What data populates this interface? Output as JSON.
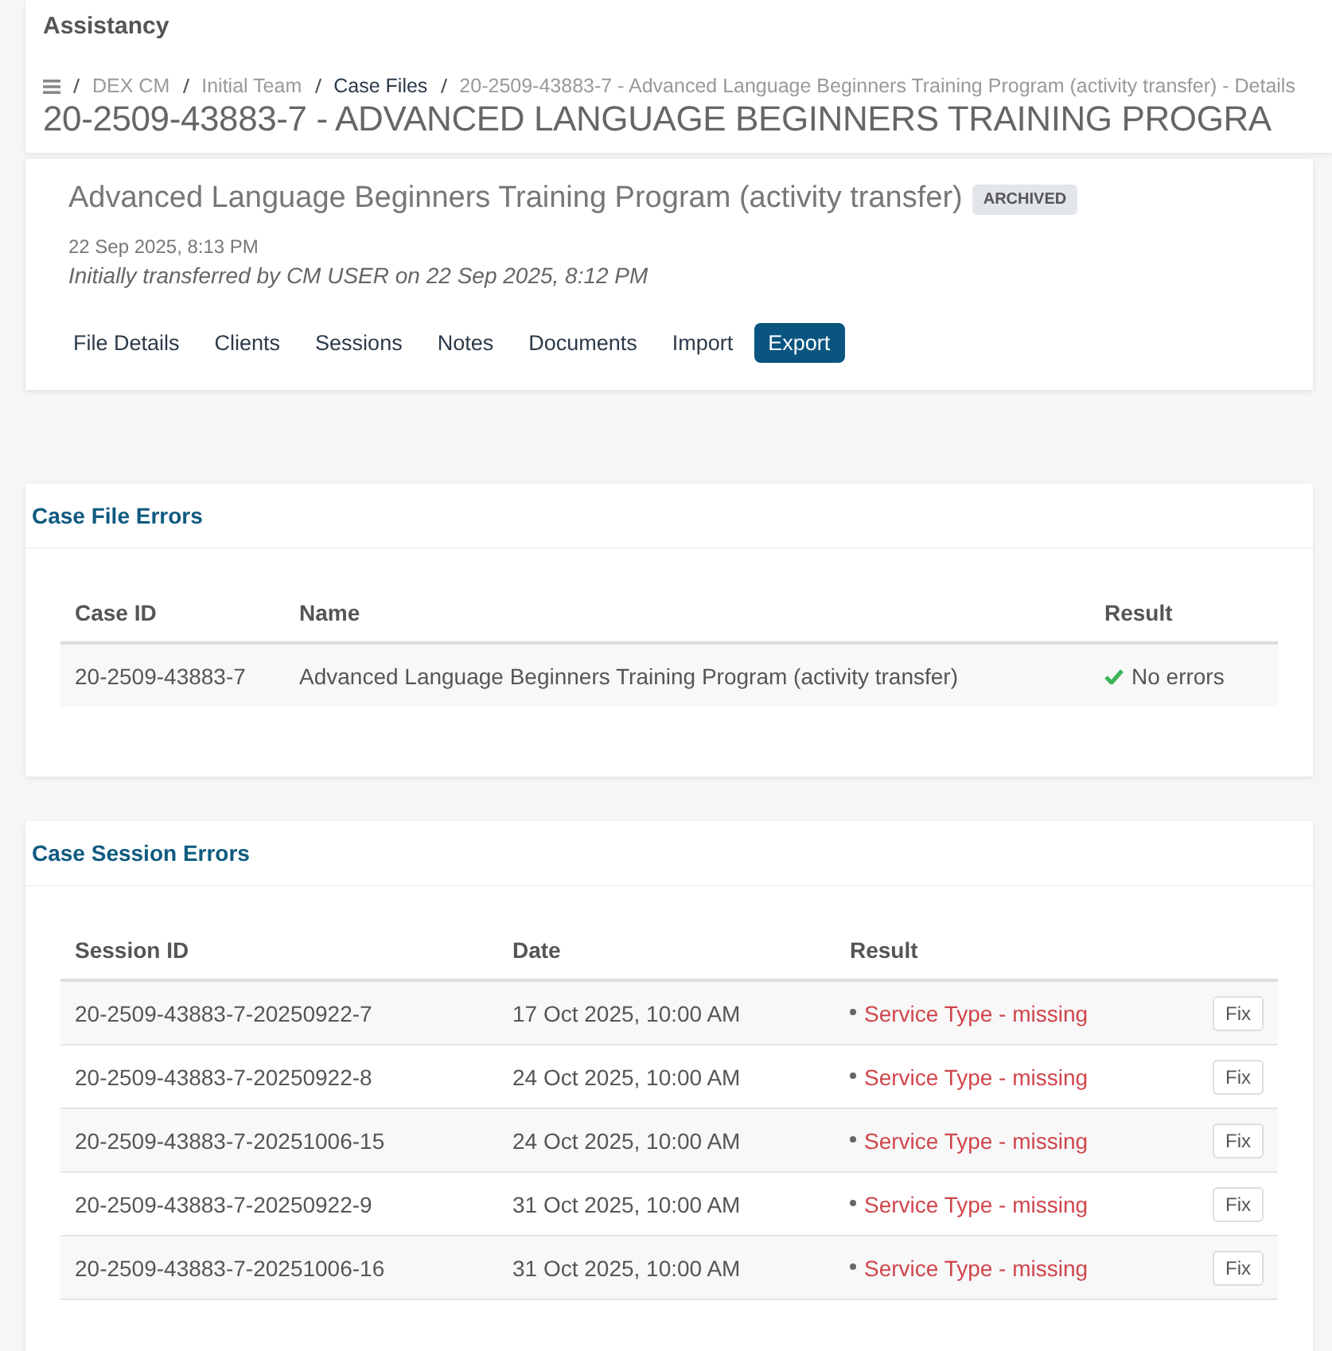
{
  "app_title": "Assistancy",
  "breadcrumb": [
    {
      "label": "DEX CM",
      "current": false
    },
    {
      "label": "Initial Team",
      "current": false
    },
    {
      "label": "Case Files",
      "current": true
    },
    {
      "label": "20-2509-43883-7 - Advanced Language Beginners Training Program (activity transfer) - Details",
      "current": false
    }
  ],
  "page_title": "20-2509-43883-7 - ADVANCED LANGUAGE BEGINNERS TRAINING PROGRA",
  "case_file": {
    "name": "Advanced Language Beginners Training Program (activity transfer)",
    "badge": "ARCHIVED",
    "timestamp": "22 Sep 2025, 8:13 PM",
    "note": "Initially transferred by CM USER on 22 Sep 2025, 8:12 PM"
  },
  "tabs": [
    {
      "label": "File Details",
      "selected": false
    },
    {
      "label": "Clients",
      "selected": false
    },
    {
      "label": "Sessions",
      "selected": false
    },
    {
      "label": "Notes",
      "selected": false
    },
    {
      "label": "Documents",
      "selected": false
    },
    {
      "label": "Import",
      "selected": false
    },
    {
      "label": "Export",
      "selected": true
    }
  ],
  "case_file_errors": {
    "title": "Case File Errors",
    "columns": [
      "Case ID",
      "Name",
      "Result"
    ],
    "rows": [
      {
        "case_id": "20-2509-43883-7",
        "name": "Advanced Language Beginners Training Program (activity transfer)",
        "result": "No errors",
        "ok": true
      }
    ]
  },
  "case_session_errors": {
    "title": "Case Session Errors",
    "columns": [
      "Session ID",
      "Date",
      "Result"
    ],
    "rows": [
      {
        "session_id": "20-2509-43883-7-20250922-7",
        "date": "17 Oct 2025, 10:00 AM",
        "result": "Service Type - missing",
        "action": "Fix"
      },
      {
        "session_id": "20-2509-43883-7-20250922-8",
        "date": "24 Oct 2025, 10:00 AM",
        "result": "Service Type - missing",
        "action": "Fix"
      },
      {
        "session_id": "20-2509-43883-7-20251006-15",
        "date": "24 Oct 2025, 10:00 AM",
        "result": "Service Type - missing",
        "action": "Fix"
      },
      {
        "session_id": "20-2509-43883-7-20250922-9",
        "date": "31 Oct 2025, 10:00 AM",
        "result": "Service Type - missing",
        "action": "Fix"
      },
      {
        "session_id": "20-2509-43883-7-20251006-16",
        "date": "31 Oct 2025, 10:00 AM",
        "result": "Service Type - missing",
        "action": "Fix"
      }
    ]
  }
}
